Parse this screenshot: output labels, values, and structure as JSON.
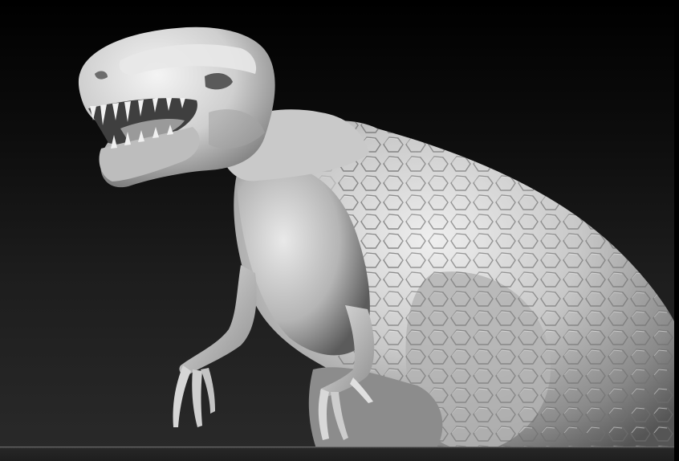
{
  "scene": {
    "subject": "sculpted-dinosaur-model",
    "colors": {
      "background_top": "#000000",
      "background_bottom": "#2a2a2a",
      "clay_light": "#e6e6e6",
      "clay_mid": "#a9a9a9",
      "clay_shadow": "#4a4a4a",
      "bottom_bar": "#262626"
    }
  }
}
